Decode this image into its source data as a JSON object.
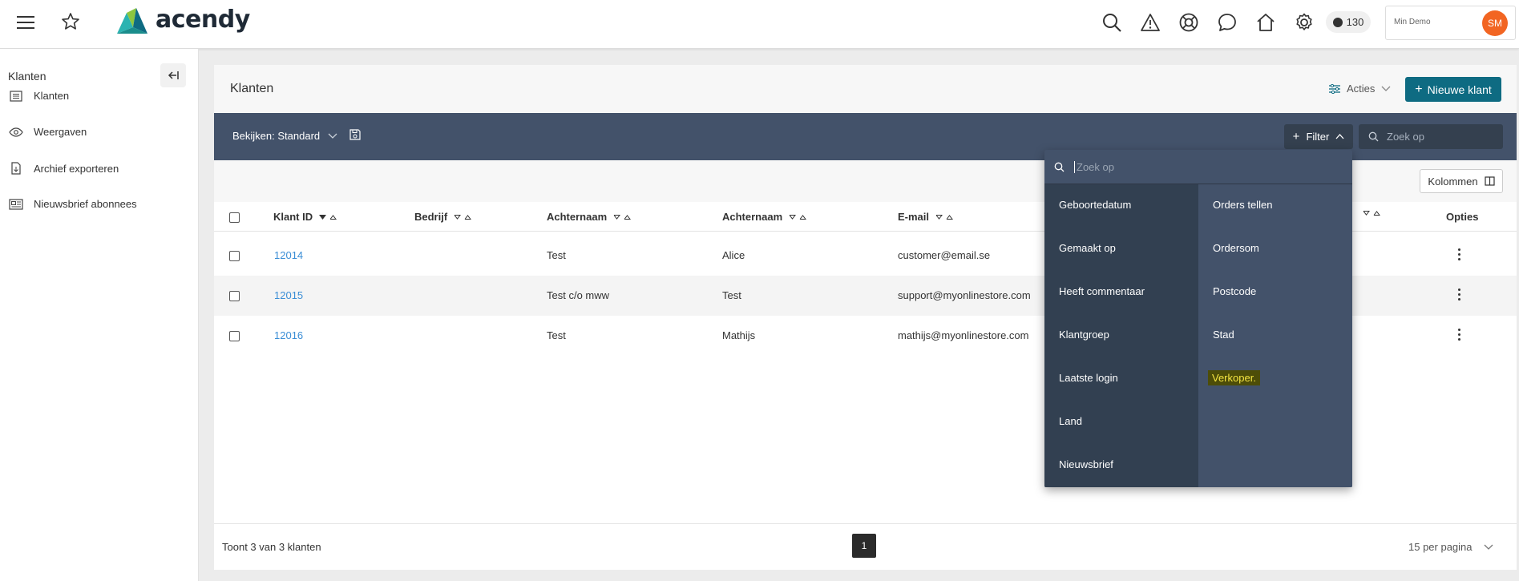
{
  "app": {
    "brand": "acendy",
    "counter": "130",
    "user_name": "Min Demo",
    "user_initials": "SM"
  },
  "sidebar": {
    "title": "Klanten",
    "items": [
      {
        "label": "Klanten",
        "icon": "list-icon"
      },
      {
        "label": "Weergaven",
        "icon": "eye-icon"
      },
      {
        "label": "Archief exporteren",
        "icon": "file-export-icon"
      },
      {
        "label": "Nieuwsbrief abonnees",
        "icon": "newspaper-icon"
      }
    ]
  },
  "page": {
    "title": "Klanten",
    "actions_label": "Acties",
    "new_button": "Nieuwe klant",
    "view_label": "Bekijken: Standard",
    "filter_label": "Filter",
    "search_placeholder": "Zoek op",
    "columns_button": "Kolommen"
  },
  "table": {
    "headers": [
      "Klant ID",
      "Bedrijf",
      "Achternaam",
      "Achternaam",
      "E-mail",
      "Opties"
    ],
    "rows": [
      {
        "id": "12014",
        "company": "",
        "lastname": "Test",
        "lastname2": "Alice",
        "email": "customer@email.se"
      },
      {
        "id": "12015",
        "company": "",
        "lastname": "Test c/o mww",
        "lastname2": "Test",
        "email": "support@myonlinestore.com"
      },
      {
        "id": "12016",
        "company": "",
        "lastname": "Test",
        "lastname2": "Mathijs",
        "email": "mathijs@myonlinestore.com"
      }
    ]
  },
  "footer": {
    "summary": "Toont 3 van 3 klanten",
    "page": "1",
    "per_page": "15 per pagina"
  },
  "filter_dropdown": {
    "search_placeholder": "Zoek op",
    "left": [
      "Geboortedatum",
      "Gemaakt op",
      "Heeft commentaar",
      "Klantgroep",
      "Laatste login",
      "Land",
      "Nieuwsbrief"
    ],
    "right": [
      "Orders tellen",
      "Ordersom",
      "Postcode",
      "Stad",
      "Verkoper."
    ]
  },
  "colors": {
    "primary": "#0e6b82",
    "toolbar": "#43526a",
    "link": "#3b8ed6",
    "avatar": "#f26522"
  }
}
